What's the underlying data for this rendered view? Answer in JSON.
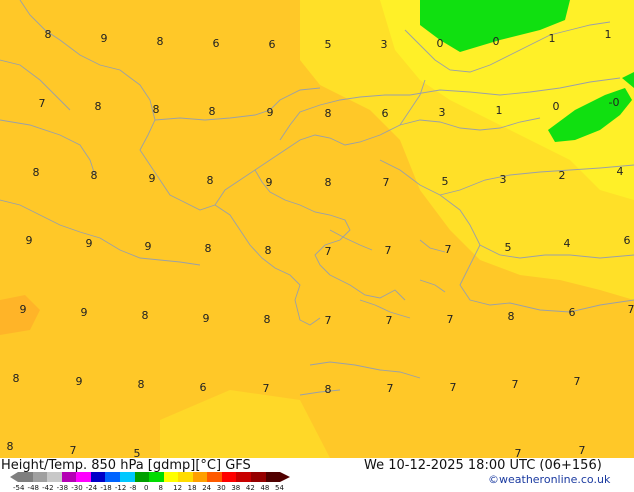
{
  "footer": {
    "title": "Height/Temp. 850 hPa [gdmp][°C] GFS",
    "datetime": "We 10-12-2025 18:00 UTC (06+156)",
    "credit": "©weatheronline.co.uk"
  },
  "legend": {
    "ticks": [
      "-54",
      "-48",
      "-42",
      "-38",
      "-30",
      "-24",
      "-18",
      "-12",
      "-8",
      "0",
      "8",
      "12",
      "18",
      "24",
      "30",
      "38",
      "42",
      "48",
      "54"
    ],
    "colors": [
      "#7f7f7f",
      "#a0a0a0",
      "#c8c8c8",
      "#b400b4",
      "#ff00ff",
      "#0000c8",
      "#0064ff",
      "#00c8ff",
      "#00a000",
      "#00dc00",
      "#ffff00",
      "#ffdc00",
      "#ffa000",
      "#ff5a00",
      "#ff0000",
      "#c80000",
      "#960000",
      "#500000"
    ]
  },
  "colors": {
    "fill_main": "#FFC828",
    "fill_light": "#FFE028",
    "fill_yellow": "#FFF028",
    "fill_green": "#10E010",
    "coast": "#9AA0A8"
  },
  "labels": [
    "8",
    "9",
    "8",
    "6",
    "6",
    "5",
    "3",
    "0",
    "0",
    "1",
    "1",
    "7",
    "8",
    "8",
    "8",
    "9",
    "8",
    "6",
    "3",
    "1",
    "0",
    "-0",
    "8",
    "8",
    "9",
    "8",
    "9",
    "8",
    "7",
    "5",
    "3",
    "2",
    "4",
    "9",
    "9",
    "9",
    "8",
    "8",
    "7",
    "7",
    "7",
    "5",
    "4",
    "6",
    "9",
    "9",
    "8",
    "9",
    "8",
    "7",
    "7",
    "7",
    "8",
    "6",
    "7",
    "8",
    "9",
    "8",
    "6",
    "7",
    "8",
    "7",
    "7",
    "7",
    "7",
    "8",
    "7",
    "5",
    "7",
    "7"
  ]
}
